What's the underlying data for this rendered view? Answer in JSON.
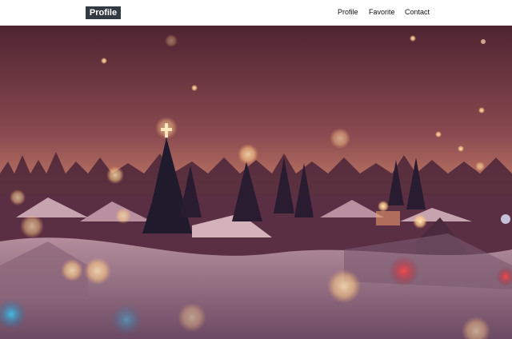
{
  "navbar": {
    "brand": "Profile",
    "links": [
      {
        "label": "Profile"
      },
      {
        "label": "Favorite"
      },
      {
        "label": "Contact"
      }
    ]
  },
  "hero": {
    "scene": "snowy-village-night-bokeh",
    "colors": {
      "sky_top": "#5a2a35",
      "sky_mid": "#a0605c",
      "horizon": "#e5a87a",
      "snow": "#c9a8b0"
    }
  }
}
